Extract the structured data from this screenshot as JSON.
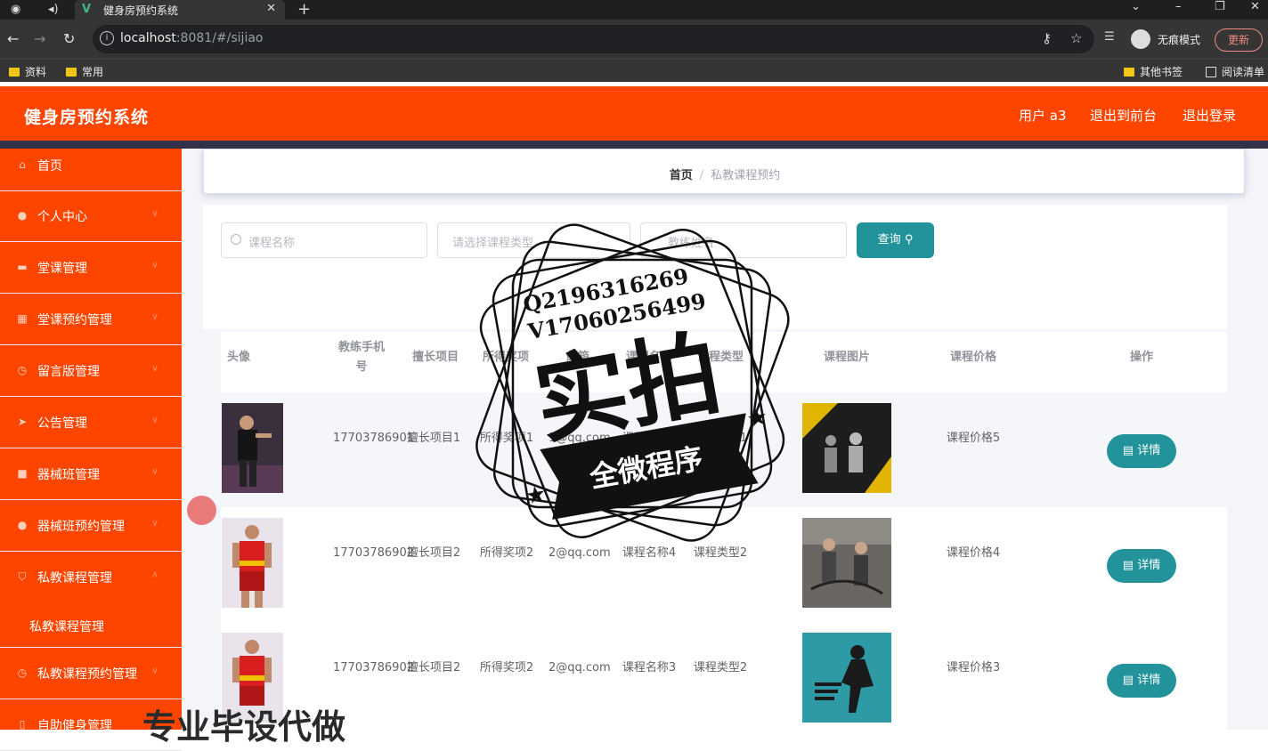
{
  "browser": {
    "tab_title": "健身房预约系统",
    "url_host": "localhost",
    "url_port": ":8081",
    "url_path": "/#/sijiao",
    "incognito_label": "无痕模式",
    "update_label": "更新",
    "bookmarks": [
      "资料",
      "常用"
    ],
    "other_bookmarks": "其他书签",
    "reading_list": "阅读清单"
  },
  "header": {
    "title": "健身房预约系统",
    "user": "用户 a3",
    "to_front": "退出到前台",
    "logout": "退出登录"
  },
  "sidebar": {
    "items": [
      {
        "label": "首页",
        "icon": "home-icon"
      },
      {
        "label": "个人中心",
        "icon": "user-icon"
      },
      {
        "label": "堂课管理",
        "icon": "briefcase-icon"
      },
      {
        "label": "堂课预约管理",
        "icon": "grid-icon"
      },
      {
        "label": "留言版管理",
        "icon": "clock-icon"
      },
      {
        "label": "公告管理",
        "icon": "send-icon"
      },
      {
        "label": "器械班管理",
        "icon": "box-icon"
      },
      {
        "label": "器械班预约管理",
        "icon": "user-icon"
      },
      {
        "label": "私教课程管理",
        "icon": "shield-icon"
      },
      {
        "label": "私教课程预约管理",
        "icon": "clock-icon"
      },
      {
        "label": "自助健身管理",
        "icon": "doc-icon"
      }
    ],
    "sub_item": "私教课程管理"
  },
  "breadcrumb": {
    "home": "首页",
    "current": "私教课程预约"
  },
  "search": {
    "course_name_ph": "课程名称",
    "course_type_ph": "请选择课程类型",
    "coach_name_ph": "教练姓名",
    "query_label": "查询"
  },
  "table": {
    "headers": [
      "头像",
      "教练手机号",
      "擅长项目",
      "所得奖项",
      "邮箱",
      "课程名称",
      "课程类型",
      "课程图片",
      "课程价格",
      "操作"
    ],
    "detail_label": "详情",
    "rows": [
      {
        "phone": "17703786901",
        "skill": "擅长项目1",
        "award": "所得奖项1",
        "email": "1@qq.com",
        "course": "课程名称5",
        "type": "课程类型1",
        "price": "课程价格5"
      },
      {
        "phone": "17703786902",
        "skill": "擅长项目2",
        "award": "所得奖项2",
        "email": "2@qq.com",
        "course": "课程名称4",
        "type": "课程类型2",
        "price": "课程价格4"
      },
      {
        "phone": "17703786902",
        "skill": "擅长项目2",
        "award": "所得奖项2",
        "email": "2@qq.com",
        "course": "课程名称3",
        "type": "课程类型2",
        "price": "课程价格3"
      }
    ]
  },
  "overlay": {
    "qq": "Q2196316269",
    "wechat": "V17060256499",
    "big": "实拍",
    "ribbon": "全微程序",
    "bottom": "专业毕设代做"
  },
  "colors": {
    "primary": "#fe4500",
    "teal": "#23939b",
    "strip": "#33324a"
  }
}
